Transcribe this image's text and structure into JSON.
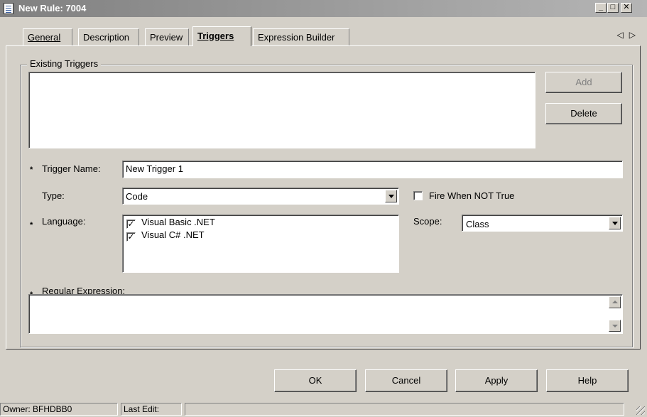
{
  "window": {
    "title": "New Rule: 7004",
    "controls": {
      "minimize": "_",
      "maximize": "□",
      "close": "✕"
    }
  },
  "tabs": [
    {
      "label": "General",
      "active": false
    },
    {
      "label": "Description",
      "active": false
    },
    {
      "label": "Preview",
      "active": false
    },
    {
      "label": "Triggers",
      "active": true
    },
    {
      "label": "Expression Builder",
      "active": false
    }
  ],
  "tab_scroll": {
    "left": "◁",
    "right": "▷"
  },
  "existing_triggers": {
    "title": "Existing Triggers",
    "items": [],
    "add_label": "Add",
    "delete_label": "Delete"
  },
  "form": {
    "required_marker": "*",
    "trigger_name_label": "Trigger Name:",
    "trigger_name_value": "New Trigger  1",
    "type_label": "Type:",
    "type_value": "Code",
    "fire_when_not_true_label": "Fire When NOT True",
    "fire_when_not_true_checked": false,
    "language_label": "Language:",
    "languages": [
      {
        "label": "Visual Basic .NET",
        "checked": true
      },
      {
        "label": "Visual C# .NET",
        "checked": true
      }
    ],
    "scope_label": "Scope:",
    "scope_value": "Class",
    "regex_label": "Regular Expression:",
    "regex_value": ""
  },
  "buttons": {
    "ok": "OK",
    "cancel": "Cancel",
    "apply": "Apply",
    "help": "Help"
  },
  "status": {
    "owner": "Owner: BFHDBB0",
    "last_edit": "Last Edit:",
    "extra": ""
  }
}
